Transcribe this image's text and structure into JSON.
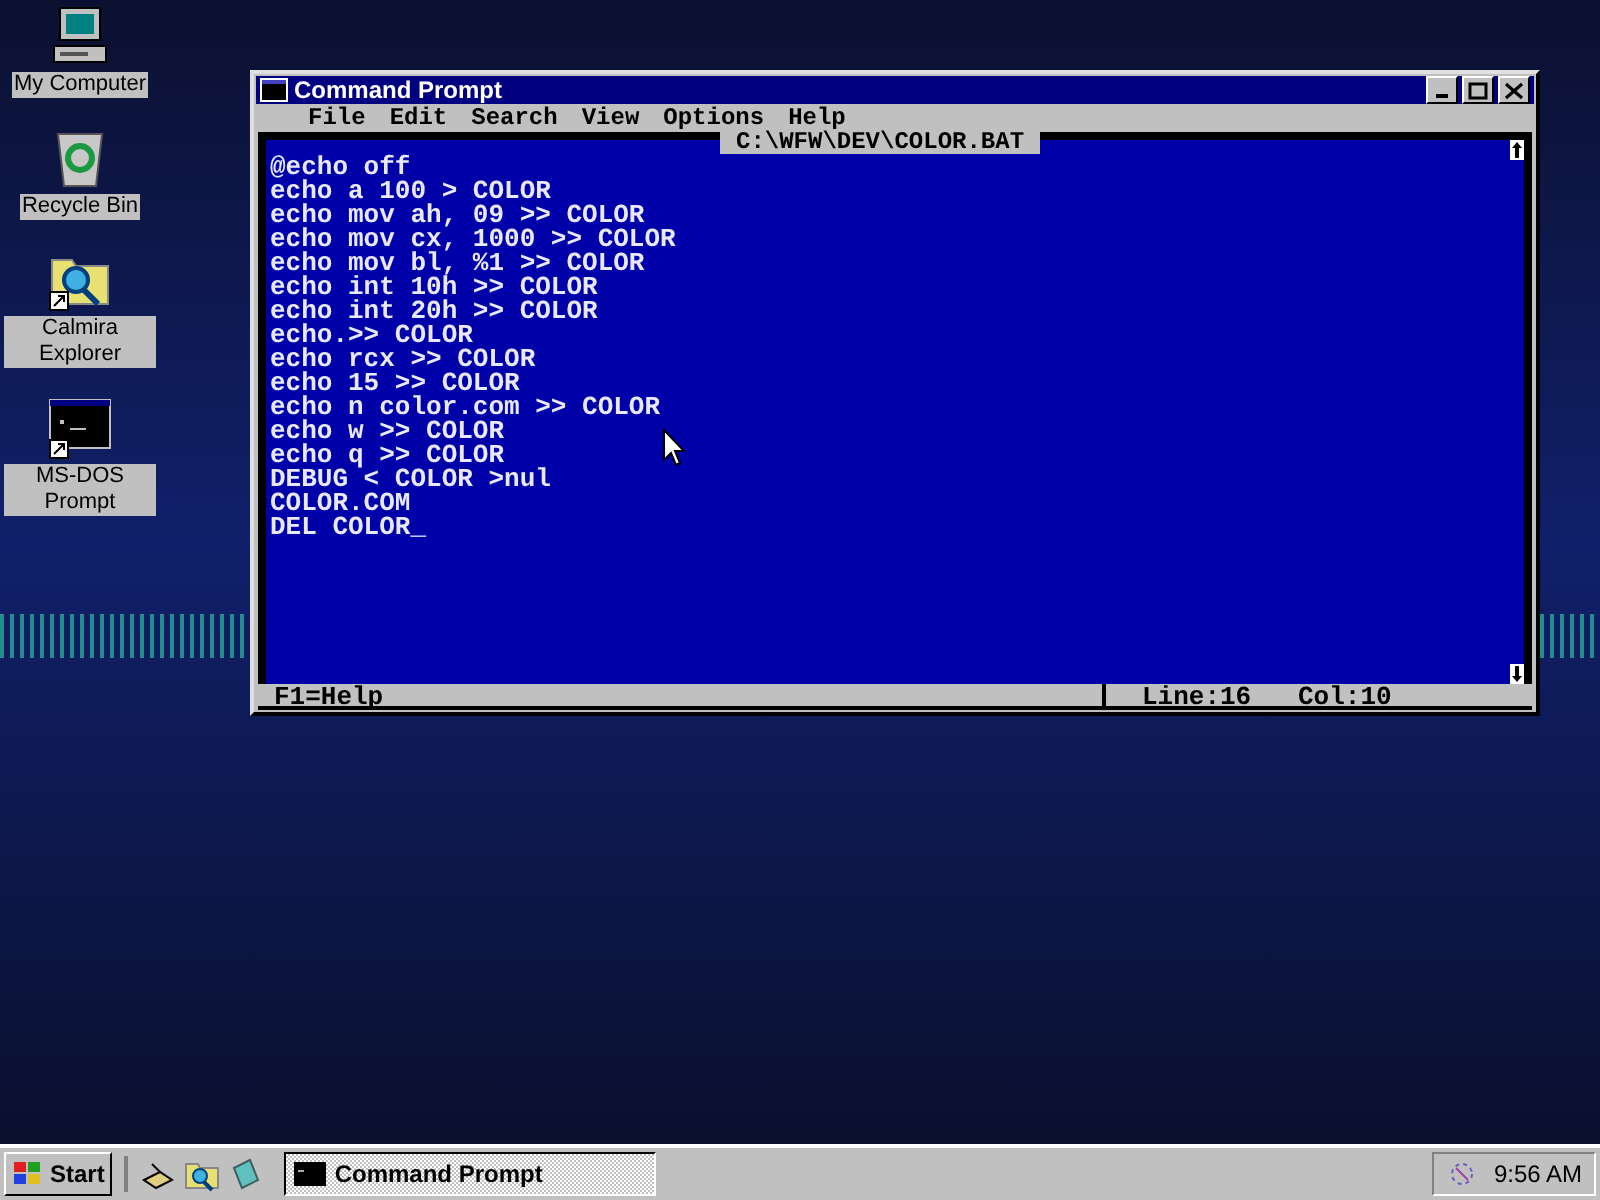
{
  "desktop_icons": [
    {
      "kind": "computer",
      "label": "My Computer"
    },
    {
      "kind": "recycle",
      "label": "Recycle Bin"
    },
    {
      "kind": "explorer",
      "label": "Calmira Explorer"
    },
    {
      "kind": "dos",
      "label": "MS-DOS Prompt"
    }
  ],
  "window": {
    "title": "Command Prompt",
    "menu": [
      "File",
      "Edit",
      "Search",
      "View",
      "Options",
      "Help"
    ],
    "file_path": "C:\\WFW\\DEV\\COLOR.BAT",
    "lines": [
      "@echo off",
      "echo a 100 > COLOR",
      "echo mov ah, 09 >> COLOR",
      "echo mov cx, 1000 >> COLOR",
      "echo mov bl, %1 >> COLOR",
      "echo int 10h >> COLOR",
      "echo int 20h >> COLOR",
      "echo.>> COLOR",
      "echo rcx >> COLOR",
      "echo 15 >> COLOR",
      "echo n color.com >> COLOR",
      "echo w >> COLOR",
      "echo q >> COLOR",
      "DEBUG < COLOR >nul",
      "COLOR.COM",
      "DEL COLOR_"
    ],
    "status": {
      "help": "F1=Help",
      "line": "Line:16",
      "col": "Col:10"
    }
  },
  "taskbar": {
    "start": "Start",
    "tasks": [
      {
        "label": "Command Prompt",
        "selected": true
      }
    ],
    "clock": "9:56 AM"
  }
}
